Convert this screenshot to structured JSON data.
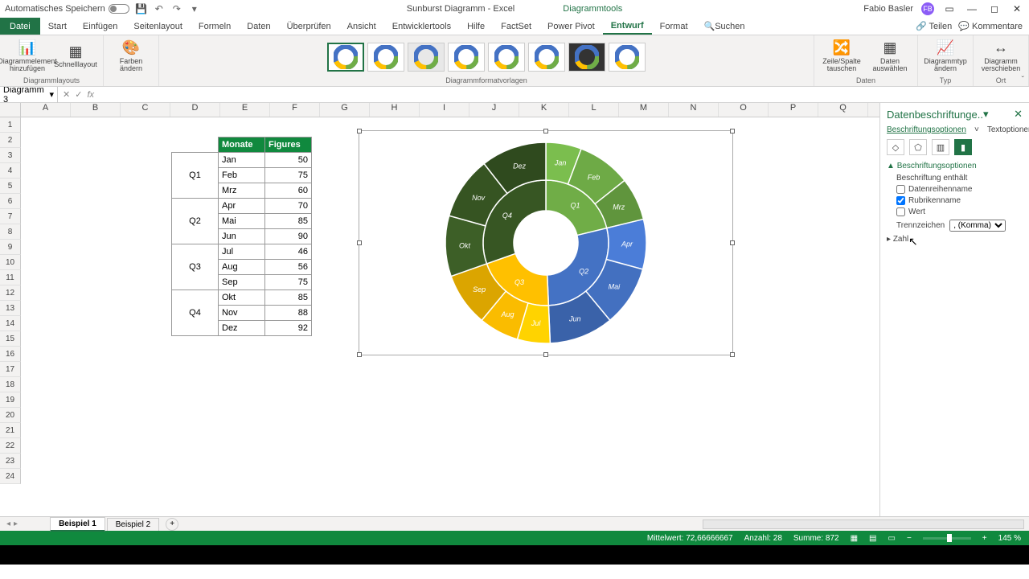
{
  "titlebar": {
    "autosave": "Automatisches Speichern",
    "doc_title": "Sunburst Diagramm - Excel",
    "context_tab": "Diagrammtools",
    "user": "Fabio Basler",
    "avatar_initials": "FB"
  },
  "tabs": {
    "file": "Datei",
    "items": [
      "Start",
      "Einfügen",
      "Seitenlayout",
      "Formeln",
      "Daten",
      "Überprüfen",
      "Ansicht",
      "Entwicklertools",
      "Hilfe",
      "FactSet",
      "Power Pivot",
      "Entwurf",
      "Format"
    ],
    "active": "Entwurf",
    "search": "Suchen",
    "share": "Teilen",
    "comments": "Kommentare"
  },
  "ribbon": {
    "group1": {
      "add_elem": "Diagrammelement hinzufügen",
      "quick": "Schnelllayout",
      "label": "Diagrammlayouts"
    },
    "group2": {
      "colors": "Farben ändern"
    },
    "styles_label": "Diagrammformatvorlagen",
    "data": {
      "switch": "Zeile/Spalte tauschen",
      "select": "Daten auswählen",
      "label": "Daten"
    },
    "type": {
      "change": "Diagrammtyp ändern",
      "label": "Typ"
    },
    "loc": {
      "move": "Diagramm verschieben",
      "label": "Ort"
    }
  },
  "formula": {
    "name": "Diagramm 3",
    "fx": "fx"
  },
  "columns": [
    "A",
    "B",
    "C",
    "D",
    "E",
    "F",
    "G",
    "H",
    "I",
    "J",
    "K",
    "L",
    "M",
    "N",
    "O",
    "P",
    "Q"
  ],
  "table": {
    "headers": [
      "Monate",
      "Figures"
    ],
    "quarters": [
      {
        "q": "Q1",
        "rows": [
          [
            "Jan",
            50
          ],
          [
            "Feb",
            75
          ],
          [
            "Mrz",
            60
          ]
        ]
      },
      {
        "q": "Q2",
        "rows": [
          [
            "Apr",
            70
          ],
          [
            "Mai",
            85
          ],
          [
            "Jun",
            90
          ]
        ]
      },
      {
        "q": "Q3",
        "rows": [
          [
            "Jul",
            46
          ],
          [
            "Aug",
            56
          ],
          [
            "Sep",
            75
          ]
        ]
      },
      {
        "q": "Q4",
        "rows": [
          [
            "Okt",
            85
          ],
          [
            "Nov",
            88
          ],
          [
            "Dez",
            92
          ]
        ]
      }
    ]
  },
  "chart_data": {
    "type": "sunburst",
    "title": "",
    "inner": [
      {
        "name": "Q1",
        "color": "#70ad47",
        "children": [
          [
            "Jan",
            50
          ],
          [
            "Feb",
            75
          ],
          [
            "Mrz",
            60
          ]
        ]
      },
      {
        "name": "Q2",
        "color": "#4472c4",
        "children": [
          [
            "Apr",
            70
          ],
          [
            "Mai",
            85
          ],
          [
            "Jun",
            90
          ]
        ]
      },
      {
        "name": "Q3",
        "color": "#ffc000",
        "children": [
          [
            "Jul",
            46
          ],
          [
            "Aug",
            56
          ],
          [
            "Sep",
            75
          ]
        ]
      },
      {
        "name": "Q4",
        "color": "#375623",
        "children": [
          [
            "Okt",
            85
          ],
          [
            "Nov",
            88
          ],
          [
            "Dez",
            92
          ]
        ]
      }
    ],
    "total": 872
  },
  "pane": {
    "title": "Datenbeschriftunge..",
    "tab1": "Beschriftungsoptionen",
    "tab2": "Textoptionen",
    "section": "Beschriftungsoptionen",
    "contains": "Beschriftung enthält",
    "series_name": "Datenreihenname",
    "cat_name": "Rubrikenname",
    "value": "Wert",
    "sep": "Trennzeichen",
    "sep_val": ", (Komma)",
    "number": "Zahl"
  },
  "sheets": {
    "s1": "Beispiel 1",
    "s2": "Beispiel 2"
  },
  "status": {
    "mean_label": "Mittelwert:",
    "mean": "72,66666667",
    "count_label": "Anzahl:",
    "count": "28",
    "sum_label": "Summe:",
    "sum": "872",
    "zoom": "145 %"
  }
}
